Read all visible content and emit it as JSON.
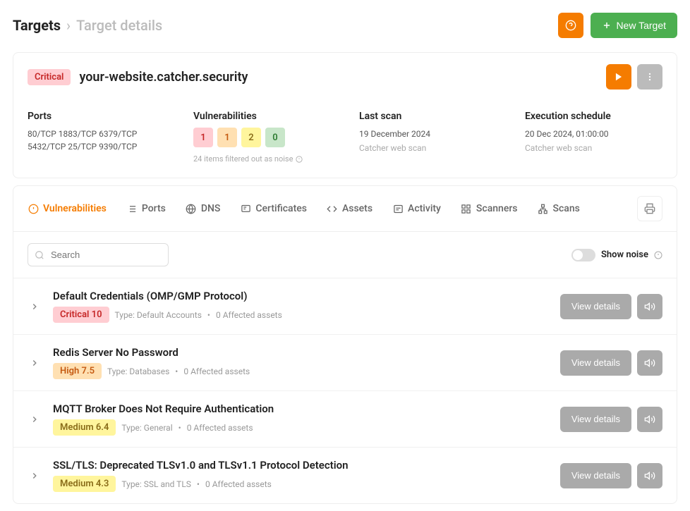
{
  "breadcrumb": {
    "root": "Targets",
    "current": "Target details"
  },
  "header": {
    "new_target": "New Target"
  },
  "target": {
    "severity": "Critical",
    "name": "your-website.catcher.security"
  },
  "summary": {
    "ports": {
      "label": "Ports",
      "list": "80/TCP 1883/TCP 6379/TCP 5432/TCP 25/TCP 9390/TCP"
    },
    "vulns": {
      "label": "Vulnerabilities",
      "critical": "1",
      "high": "1",
      "medium": "2",
      "info": "0",
      "filtered": "24 items filtered out as noise"
    },
    "last_scan": {
      "label": "Last scan",
      "date": "19 December 2024",
      "type": "Catcher web scan"
    },
    "schedule": {
      "label": "Execution schedule",
      "date": "20 Dec 2024, 01:00:00",
      "type": "Catcher web scan"
    }
  },
  "tabs": {
    "vulnerabilities": "Vulnerabilities",
    "ports": "Ports",
    "dns": "DNS",
    "certificates": "Certificates",
    "assets": "Assets",
    "activity": "Activity",
    "scanners": "Scanners",
    "scans": "Scans"
  },
  "search": {
    "placeholder": "Search"
  },
  "noise": {
    "label": "Show noise"
  },
  "vulnerabilities": [
    {
      "title": "Default Credentials (OMP/GMP Protocol)",
      "severity": "Critical 10",
      "sev_class": "badge-critical",
      "type": "Type: Default Accounts",
      "affected": "0 Affected assets"
    },
    {
      "title": "Redis Server No Password",
      "severity": "High 7.5",
      "sev_class": "badge-high",
      "type": "Type: Databases",
      "affected": "0 Affected assets"
    },
    {
      "title": "MQTT Broker Does Not Require Authentication",
      "severity": "Medium 6.4",
      "sev_class": "badge-medium",
      "type": "Type: General",
      "affected": "0 Affected assets"
    },
    {
      "title": "SSL/TLS: Deprecated TLSv1.0 and TLSv1.1 Protocol Detection",
      "severity": "Medium 4.3",
      "sev_class": "badge-medium",
      "type": "Type: SSL and TLS",
      "affected": "0 Affected assets"
    }
  ],
  "buttons": {
    "view_details": "View details"
  }
}
